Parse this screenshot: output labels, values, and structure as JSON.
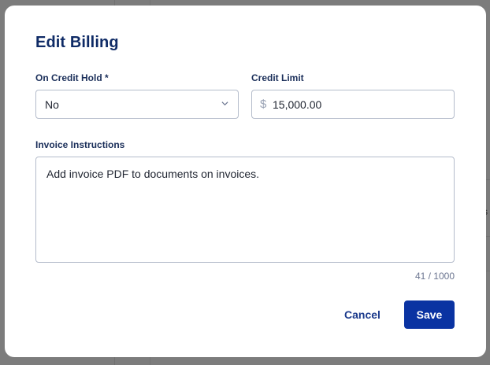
{
  "dialog": {
    "title": "Edit Billing",
    "credit_hold": {
      "label": "On Credit Hold *",
      "value": "No"
    },
    "credit_limit": {
      "label": "Credit Limit",
      "currency_symbol": "$",
      "value": "15,000.00"
    },
    "invoice_instructions": {
      "label": "Invoice Instructions",
      "value": "Add invoice PDF to documents on invoices.",
      "counter": "41 / 1000"
    },
    "buttons": {
      "cancel": "Cancel",
      "save": "Save"
    }
  },
  "background": {
    "clipped_text": "s"
  },
  "colors": {
    "primary": "#0a33a2",
    "title": "#0f2b66",
    "border": "#b4bccb"
  }
}
